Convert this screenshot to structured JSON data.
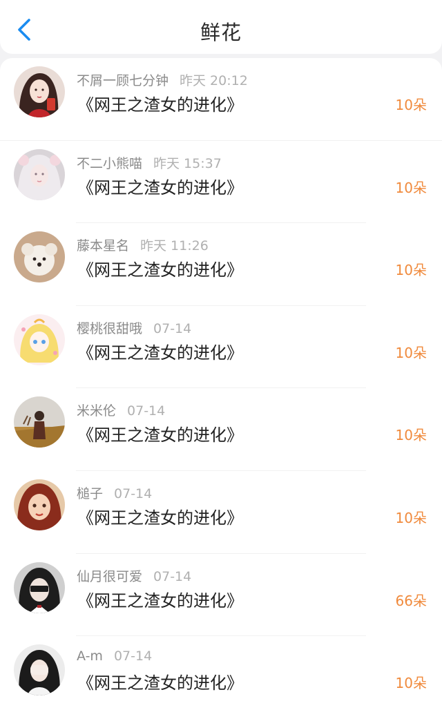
{
  "header": {
    "title": "鲜花",
    "back_icon": "chevron-left-icon",
    "accent_color": "#1a8cf0"
  },
  "colors": {
    "count": "#f08a3c",
    "name": "#8a8a8a",
    "time": "#b0b0b0"
  },
  "gifts": [
    {
      "user": "不屑一顾七分钟",
      "time": "昨天 20:12",
      "book": "《网王之渣女的进化》",
      "count": "10朵"
    },
    {
      "user": "不二小熊喵",
      "time": "昨天 15:37",
      "book": "《网王之渣女的进化》",
      "count": "10朵"
    },
    {
      "user": "藤本星名",
      "time": "昨天 11:26",
      "book": "《网王之渣女的进化》",
      "count": "10朵"
    },
    {
      "user": "樱桃很甜哦",
      "time": "07-14",
      "book": "《网王之渣女的进化》",
      "count": "10朵"
    },
    {
      "user": "米米伦",
      "time": "07-14",
      "book": "《网王之渣女的进化》",
      "count": "10朵"
    },
    {
      "user": "槌子",
      "time": "07-14",
      "book": "《网王之渣女的进化》",
      "count": "10朵"
    },
    {
      "user": "仙月很可爱",
      "time": "07-14",
      "book": "《网王之渣女的进化》",
      "count": "66朵"
    },
    {
      "user": "A-m",
      "time": "07-14",
      "book": "《网王之渣女的进化》",
      "count": "10朵"
    }
  ]
}
